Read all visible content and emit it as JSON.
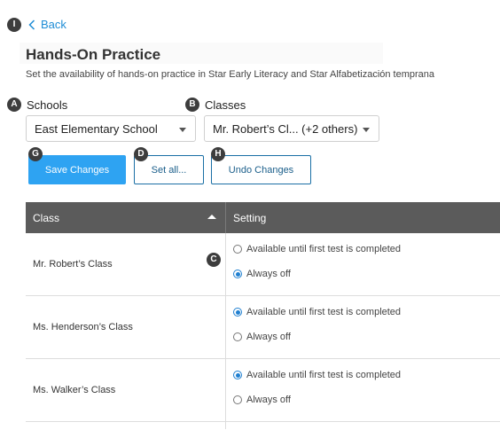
{
  "back": {
    "label": "Back"
  },
  "page": {
    "title": "Hands-On Practice",
    "subtitle": "Set the availability of hands-on practice in Star Early Literacy and Star Alfabetización temprana"
  },
  "badges": {
    "i": "I",
    "a": "A",
    "b": "B",
    "c": "C",
    "d": "D",
    "g": "G",
    "h": "H"
  },
  "schools": {
    "label": "Schools",
    "value": "East Elementary School"
  },
  "classes": {
    "label": "Classes",
    "value": "Mr. Robert’s Cl... (+2 others)"
  },
  "buttons": {
    "save": "Save Changes",
    "set_all": "Set all...",
    "undo": "Undo Changes"
  },
  "table": {
    "headers": {
      "class": "Class",
      "setting": "Setting"
    },
    "options": {
      "available": "Available until first test is completed",
      "off": "Always off"
    },
    "rows": [
      {
        "class": "Mr. Robert’s Class",
        "selected": "off"
      },
      {
        "class": "Ms. Henderson’s Class",
        "selected": "available"
      },
      {
        "class": "Ms. Walker’s Class",
        "selected": "available"
      }
    ]
  },
  "colors": {
    "accent": "#2ea3f2",
    "header_bg": "#5b5b5b",
    "link": "#1f8dd6"
  }
}
